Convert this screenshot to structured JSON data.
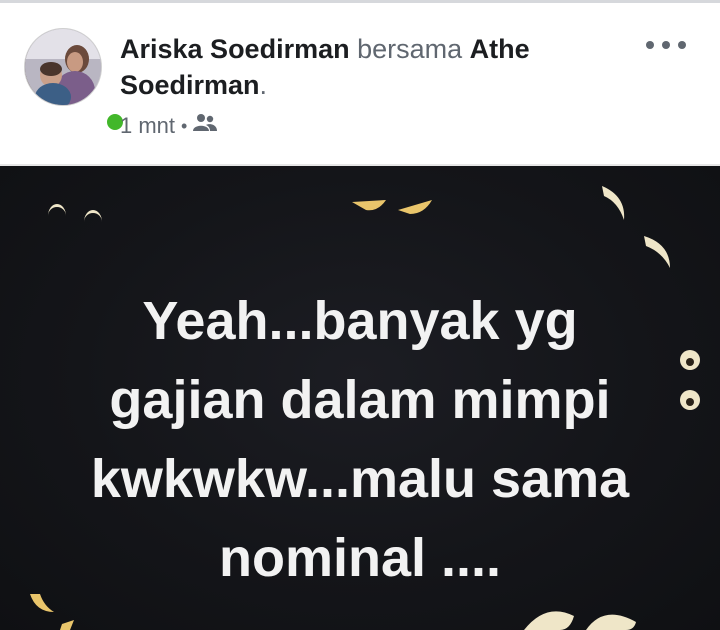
{
  "post": {
    "author": "Ariska Soedirman",
    "with_word": "bersama",
    "tagged": "Athe Soedirman",
    "tagged_suffix": ".",
    "time": "1 mnt",
    "separator": "•",
    "audience_icon": "friends-icon",
    "more_icon": "more-dots-icon",
    "online_color": "#42b72a"
  },
  "image": {
    "background_color": "#141519",
    "eye_color": "#efe6c8",
    "text_lines": [
      "Yeah...banyak yg",
      "gajian dalam mimpi",
      "kwkwkw...malu sama",
      "nominal ...."
    ]
  }
}
